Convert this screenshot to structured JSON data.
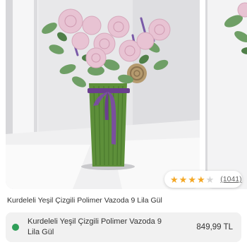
{
  "product": {
    "title": "Kurdeleli Yeşil Çizgili Polimer Vazoda 9 Lila Gül",
    "image_alt": "Kurdeleli Yeşil Çizgili Polimer Vazoda 9 Lila Gül"
  },
  "rating": {
    "stars": [
      {
        "icon": "star-full"
      },
      {
        "icon": "star-full"
      },
      {
        "icon": "star-full"
      },
      {
        "icon": "star-full"
      },
      {
        "icon": "star-empty"
      }
    ],
    "value": 4,
    "max": 5,
    "review_count": "(1041)"
  },
  "variant": {
    "name": "Kurdeleli Yeşil Çizgili Polimer Vazoda 9 Lila Gül",
    "price": "849,99 TL",
    "status_color": "#2f9e58"
  },
  "colors": {
    "star": "#f4a724",
    "vase": "#5d8f3a",
    "ribbon": "#7a4f9e",
    "rose": "#e8c3d3"
  }
}
